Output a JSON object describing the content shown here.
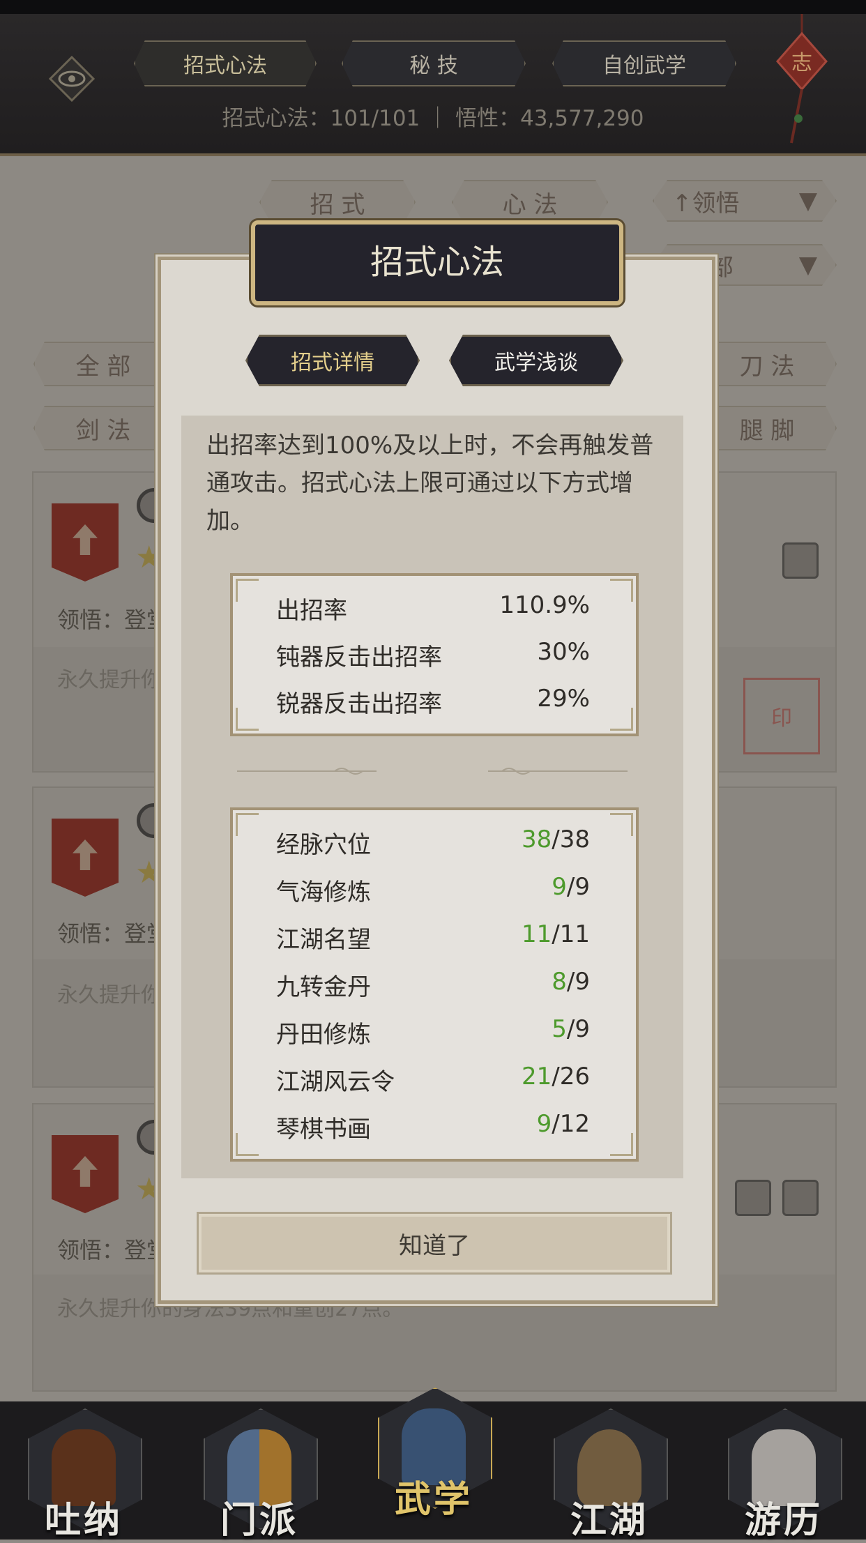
{
  "header": {
    "tabs": [
      "招式心法",
      "秘 技",
      "自创武学"
    ],
    "stats": "招式心法：101/101 ｜ 悟性：43,577,290"
  },
  "background": {
    "sub_tabs": [
      "招 式",
      "心 法"
    ],
    "sort_dropdown": "↑领悟",
    "filter_dropdown": "全部",
    "filters": [
      "全 部",
      "刀 法",
      "剑 法",
      "腿 脚"
    ],
    "cards": [
      {
        "line1": "领悟：登堂",
        "line2": "永久提升你"
      },
      {
        "line1": "领悟：登堂",
        "line2": "永久提升你"
      },
      {
        "line1": "领悟：登堂",
        "line2": "永久提升你的身法39点和重创27点。"
      }
    ]
  },
  "modal": {
    "title": "招式心法",
    "tabs": {
      "details": "招式详情",
      "talk": "武学浅谈"
    },
    "description": "出招率达到100%及以上时，不会再触发普通攻击。招式心法上限可通过以下方式增加。",
    "rates": [
      {
        "label": "出招率",
        "value": "110.9%"
      },
      {
        "label": "钝器反击出招率",
        "value": "30%"
      },
      {
        "label": "锐器反击出招率",
        "value": "29%"
      }
    ],
    "sources": [
      {
        "label": "经脉穴位",
        "current": "38",
        "max": "38"
      },
      {
        "label": "气海修炼",
        "current": "9",
        "max": "9"
      },
      {
        "label": "江湖名望",
        "current": "11",
        "max": "11"
      },
      {
        "label": "九转金丹",
        "current": "8",
        "max": "9"
      },
      {
        "label": "丹田修炼",
        "current": "5",
        "max": "9"
      },
      {
        "label": "江湖风云令",
        "current": "21",
        "max": "26"
      },
      {
        "label": "琴棋书画",
        "current": "9",
        "max": "12"
      }
    ],
    "ok": "知道了"
  },
  "nav": [
    "吐纳",
    "门派",
    "武学",
    "江湖",
    "游历"
  ]
}
